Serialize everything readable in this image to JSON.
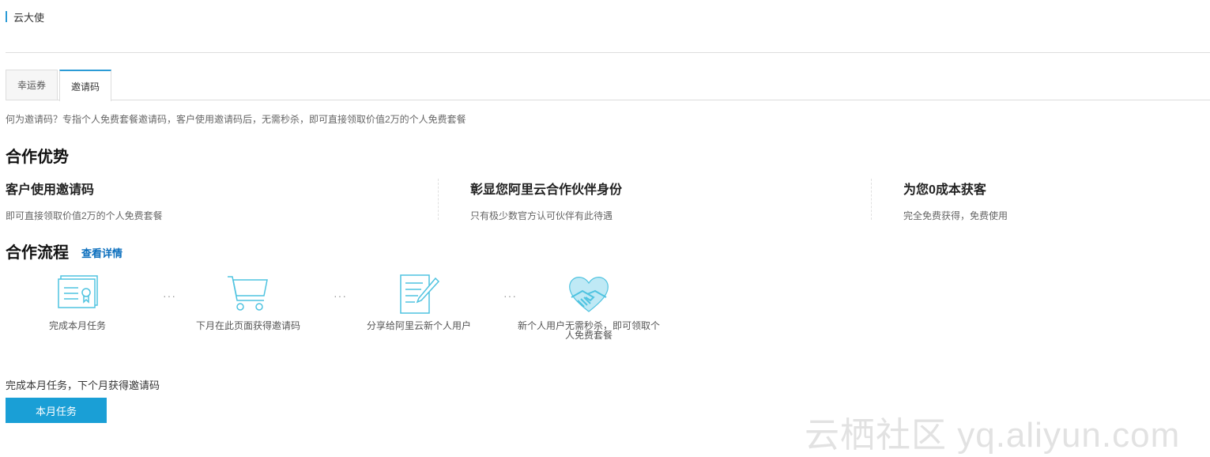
{
  "header": {
    "title": "云大使"
  },
  "tabs": [
    {
      "label": "幸运券",
      "active": false
    },
    {
      "label": "邀请码",
      "active": true
    }
  ],
  "intro": "何为邀请码？专指个人免费套餐邀请码，客户使用邀请码后，无需秒杀，即可直接领取价值2万的个人免费套餐",
  "advantages": {
    "title": "合作优势",
    "items": [
      {
        "title": "客户使用邀请码",
        "desc": "即可直接领取价值2万的个人免费套餐"
      },
      {
        "title": "彰显您阿里云合作伙伴身份",
        "desc": "只有极少数官方认可伙伴有此待遇"
      },
      {
        "title": "为您0成本获客",
        "desc": "完全免费获得，免费使用"
      }
    ]
  },
  "process": {
    "title": "合作流程",
    "detail_link": "查看详情",
    "steps": [
      {
        "label": "完成本月任务",
        "icon": "certificate-icon"
      },
      {
        "label": "下月在此页面获得邀请码",
        "icon": "cart-icon"
      },
      {
        "label": "分享给阿里云新个人用户",
        "icon": "document-edit-icon"
      },
      {
        "label": "新个人用户无需秒杀，即可领取个人免费套餐",
        "icon": "handshake-icon"
      }
    ],
    "separator": "···"
  },
  "footer": {
    "note": "完成本月任务，下个月获得邀请码",
    "button_label": "本月任务"
  },
  "watermark": "云栖社区 yq.aliyun.com",
  "colors": {
    "accent": "#1a9fd6",
    "link": "#0a6ebd",
    "icon": "#4fc3e0"
  }
}
